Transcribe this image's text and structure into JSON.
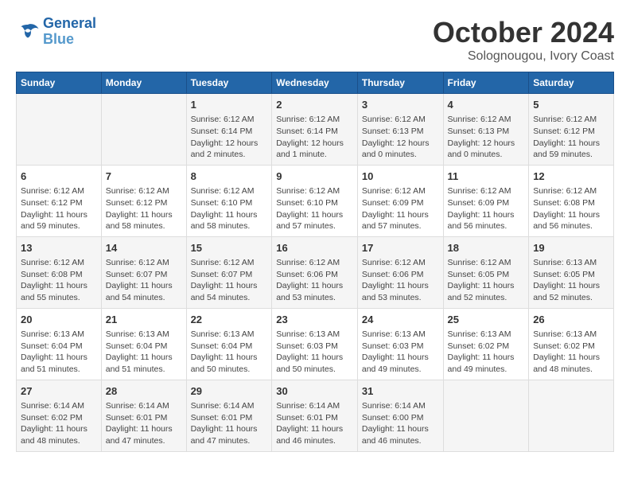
{
  "header": {
    "logo_general": "General",
    "logo_blue": "Blue",
    "month_title": "October 2024",
    "location": "Solognougou, Ivory Coast"
  },
  "weekdays": [
    "Sunday",
    "Monday",
    "Tuesday",
    "Wednesday",
    "Thursday",
    "Friday",
    "Saturday"
  ],
  "weeks": [
    [
      {
        "day": "",
        "content": ""
      },
      {
        "day": "",
        "content": ""
      },
      {
        "day": "1",
        "content": "Sunrise: 6:12 AM\nSunset: 6:14 PM\nDaylight: 12 hours\nand 2 minutes."
      },
      {
        "day": "2",
        "content": "Sunrise: 6:12 AM\nSunset: 6:14 PM\nDaylight: 12 hours\nand 1 minute."
      },
      {
        "day": "3",
        "content": "Sunrise: 6:12 AM\nSunset: 6:13 PM\nDaylight: 12 hours\nand 0 minutes."
      },
      {
        "day": "4",
        "content": "Sunrise: 6:12 AM\nSunset: 6:13 PM\nDaylight: 12 hours\nand 0 minutes."
      },
      {
        "day": "5",
        "content": "Sunrise: 6:12 AM\nSunset: 6:12 PM\nDaylight: 11 hours\nand 59 minutes."
      }
    ],
    [
      {
        "day": "6",
        "content": "Sunrise: 6:12 AM\nSunset: 6:12 PM\nDaylight: 11 hours\nand 59 minutes."
      },
      {
        "day": "7",
        "content": "Sunrise: 6:12 AM\nSunset: 6:12 PM\nDaylight: 11 hours\nand 58 minutes."
      },
      {
        "day": "8",
        "content": "Sunrise: 6:12 AM\nSunset: 6:10 PM\nDaylight: 11 hours\nand 58 minutes."
      },
      {
        "day": "9",
        "content": "Sunrise: 6:12 AM\nSunset: 6:10 PM\nDaylight: 11 hours\nand 57 minutes."
      },
      {
        "day": "10",
        "content": "Sunrise: 6:12 AM\nSunset: 6:09 PM\nDaylight: 11 hours\nand 57 minutes."
      },
      {
        "day": "11",
        "content": "Sunrise: 6:12 AM\nSunset: 6:09 PM\nDaylight: 11 hours\nand 56 minutes."
      },
      {
        "day": "12",
        "content": "Sunrise: 6:12 AM\nSunset: 6:08 PM\nDaylight: 11 hours\nand 56 minutes."
      }
    ],
    [
      {
        "day": "13",
        "content": "Sunrise: 6:12 AM\nSunset: 6:08 PM\nDaylight: 11 hours\nand 55 minutes."
      },
      {
        "day": "14",
        "content": "Sunrise: 6:12 AM\nSunset: 6:07 PM\nDaylight: 11 hours\nand 54 minutes."
      },
      {
        "day": "15",
        "content": "Sunrise: 6:12 AM\nSunset: 6:07 PM\nDaylight: 11 hours\nand 54 minutes."
      },
      {
        "day": "16",
        "content": "Sunrise: 6:12 AM\nSunset: 6:06 PM\nDaylight: 11 hours\nand 53 minutes."
      },
      {
        "day": "17",
        "content": "Sunrise: 6:12 AM\nSunset: 6:06 PM\nDaylight: 11 hours\nand 53 minutes."
      },
      {
        "day": "18",
        "content": "Sunrise: 6:12 AM\nSunset: 6:05 PM\nDaylight: 11 hours\nand 52 minutes."
      },
      {
        "day": "19",
        "content": "Sunrise: 6:13 AM\nSunset: 6:05 PM\nDaylight: 11 hours\nand 52 minutes."
      }
    ],
    [
      {
        "day": "20",
        "content": "Sunrise: 6:13 AM\nSunset: 6:04 PM\nDaylight: 11 hours\nand 51 minutes."
      },
      {
        "day": "21",
        "content": "Sunrise: 6:13 AM\nSunset: 6:04 PM\nDaylight: 11 hours\nand 51 minutes."
      },
      {
        "day": "22",
        "content": "Sunrise: 6:13 AM\nSunset: 6:04 PM\nDaylight: 11 hours\nand 50 minutes."
      },
      {
        "day": "23",
        "content": "Sunrise: 6:13 AM\nSunset: 6:03 PM\nDaylight: 11 hours\nand 50 minutes."
      },
      {
        "day": "24",
        "content": "Sunrise: 6:13 AM\nSunset: 6:03 PM\nDaylight: 11 hours\nand 49 minutes."
      },
      {
        "day": "25",
        "content": "Sunrise: 6:13 AM\nSunset: 6:02 PM\nDaylight: 11 hours\nand 49 minutes."
      },
      {
        "day": "26",
        "content": "Sunrise: 6:13 AM\nSunset: 6:02 PM\nDaylight: 11 hours\nand 48 minutes."
      }
    ],
    [
      {
        "day": "27",
        "content": "Sunrise: 6:14 AM\nSunset: 6:02 PM\nDaylight: 11 hours\nand 48 minutes."
      },
      {
        "day": "28",
        "content": "Sunrise: 6:14 AM\nSunset: 6:01 PM\nDaylight: 11 hours\nand 47 minutes."
      },
      {
        "day": "29",
        "content": "Sunrise: 6:14 AM\nSunset: 6:01 PM\nDaylight: 11 hours\nand 47 minutes."
      },
      {
        "day": "30",
        "content": "Sunrise: 6:14 AM\nSunset: 6:01 PM\nDaylight: 11 hours\nand 46 minutes."
      },
      {
        "day": "31",
        "content": "Sunrise: 6:14 AM\nSunset: 6:00 PM\nDaylight: 11 hours\nand 46 minutes."
      },
      {
        "day": "",
        "content": ""
      },
      {
        "day": "",
        "content": ""
      }
    ]
  ]
}
